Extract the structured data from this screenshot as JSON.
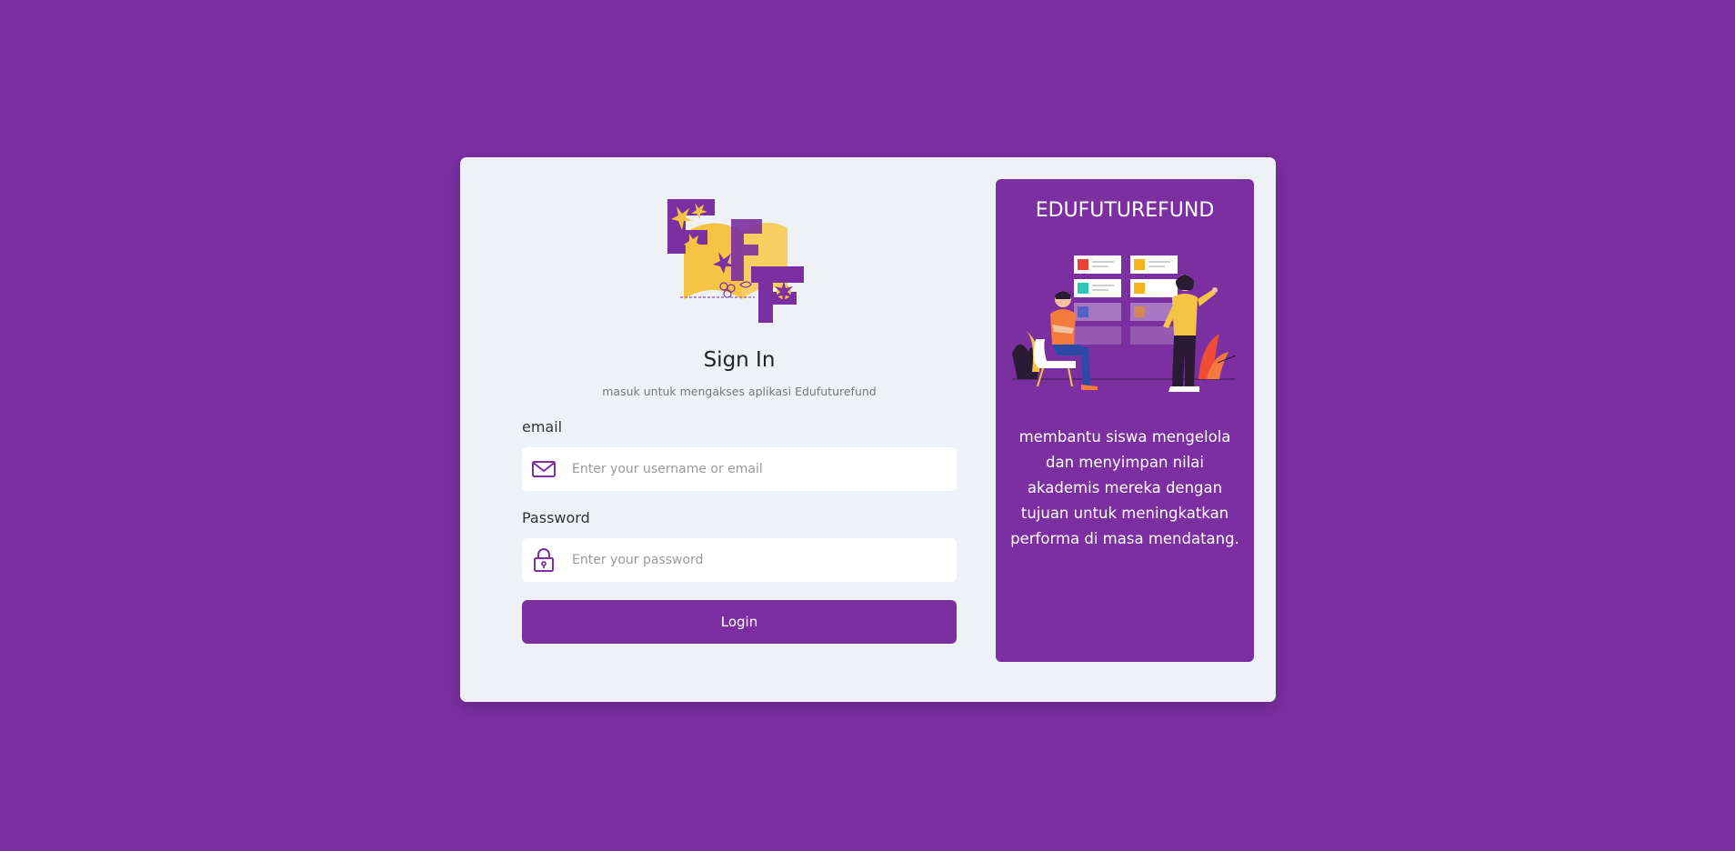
{
  "signin": {
    "title": "Sign In",
    "subtitle": "masuk untuk mengakses aplikasi Edufuturefund",
    "email_label": "email",
    "email_placeholder": "Enter your username or email",
    "password_label": "Password",
    "password_placeholder": "Enter your password",
    "login_label": "Login"
  },
  "panel": {
    "title": "EDUFUTUREFUND",
    "description": "membantu siswa mengelola dan menyimpan nilai akademis mereka dengan tujuan untuk meningkatkan performa di masa mendatang."
  },
  "icons": {
    "email": "mail-icon",
    "password": "lock-icon"
  },
  "colors": {
    "background": "#7b2fa1",
    "card": "#eef1f6",
    "accent": "#7b2fa1",
    "logo_yellow": "#f6c445"
  }
}
